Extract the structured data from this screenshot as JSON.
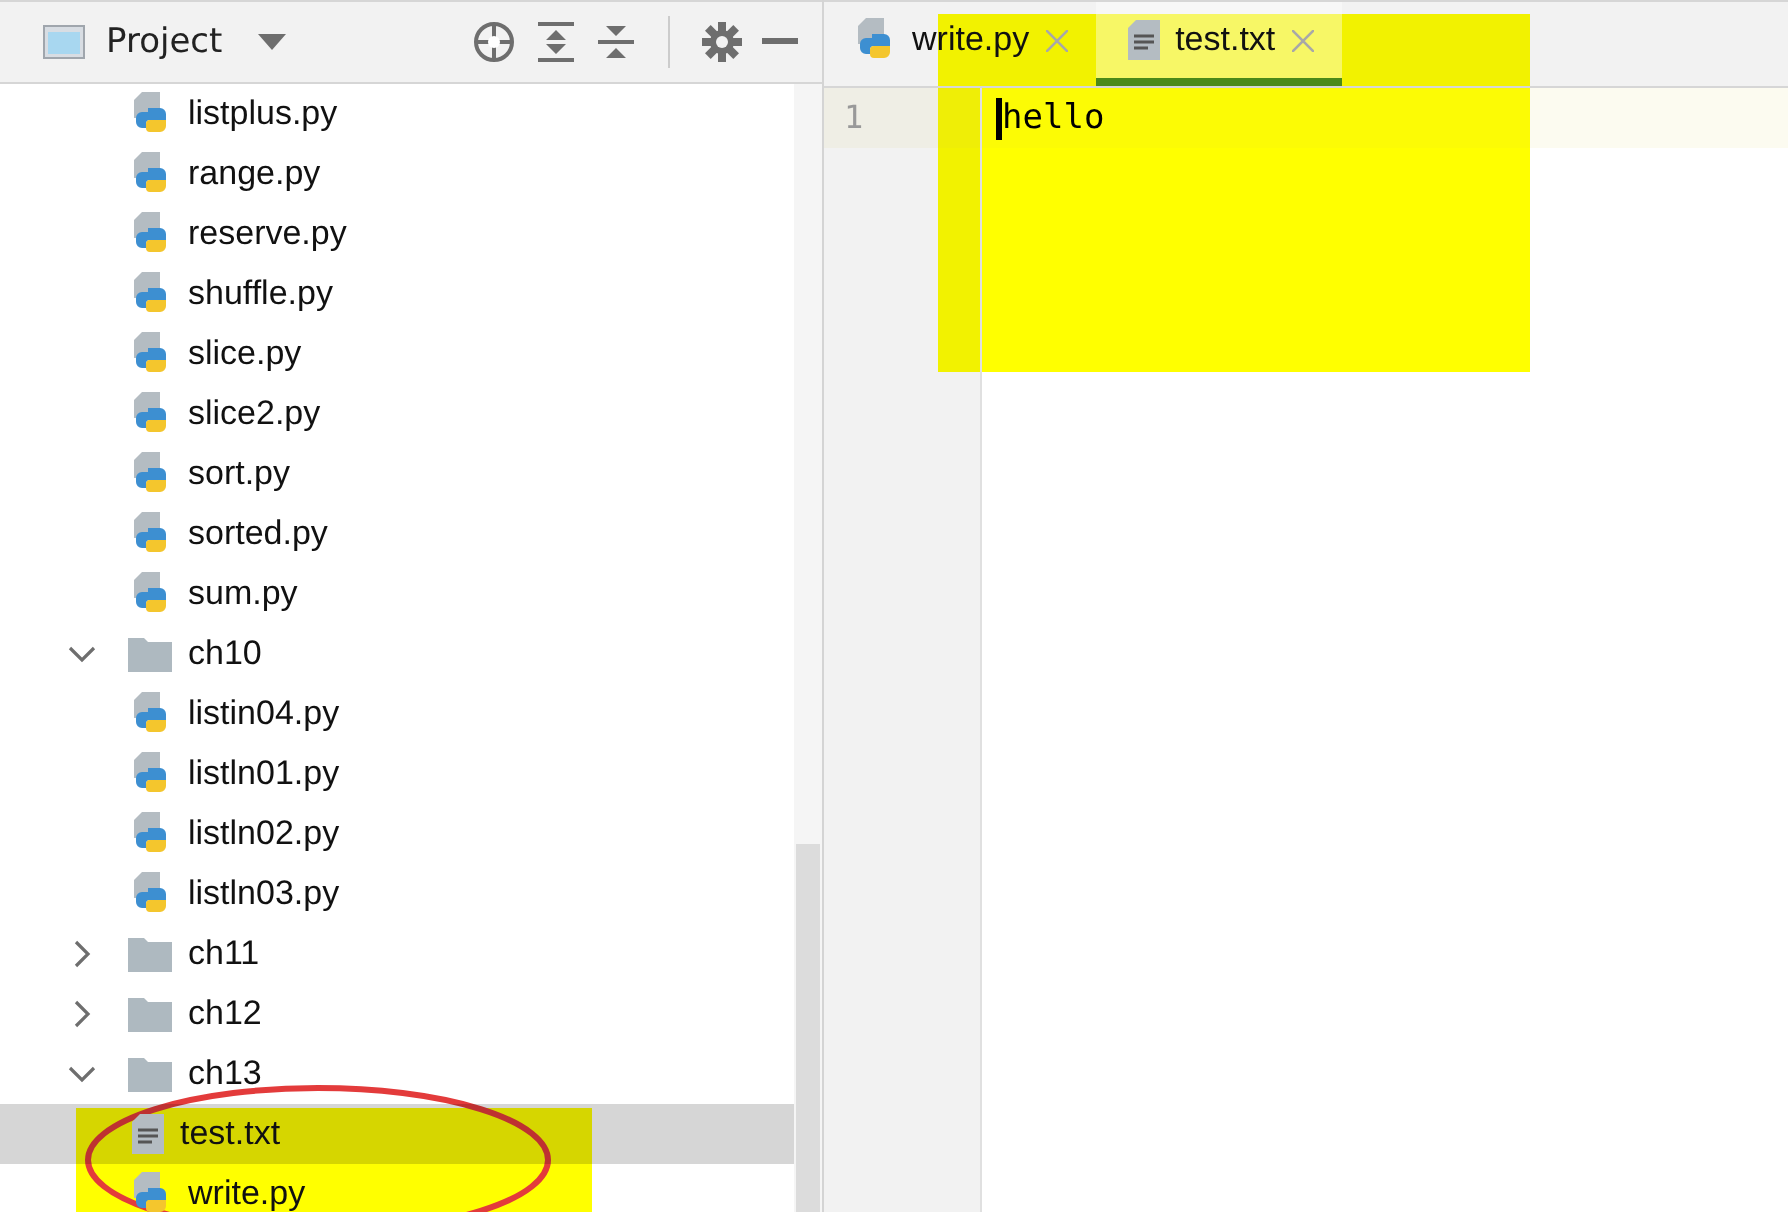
{
  "project_panel": {
    "title": "Project"
  },
  "tree": [
    {
      "kind": "group",
      "children": [
        {
          "kind": "python",
          "name": "listplus.py",
          "selected": false
        },
        {
          "kind": "python",
          "name": "range.py",
          "selected": false
        },
        {
          "kind": "python",
          "name": "reserve.py",
          "selected": false
        },
        {
          "kind": "python",
          "name": "shuffle.py",
          "selected": false
        },
        {
          "kind": "python",
          "name": "slice.py",
          "selected": false
        },
        {
          "kind": "python",
          "name": "slice2.py",
          "selected": false
        },
        {
          "kind": "python",
          "name": "sort.py",
          "selected": false
        },
        {
          "kind": "python",
          "name": "sorted.py",
          "selected": false
        },
        {
          "kind": "python",
          "name": "sum.py",
          "selected": false
        }
      ]
    },
    {
      "kind": "folder",
      "name": "ch10",
      "expanded": true,
      "selected": false,
      "children": [
        {
          "kind": "python",
          "name": "listin04.py",
          "selected": false
        },
        {
          "kind": "python",
          "name": "listln01.py",
          "selected": false
        },
        {
          "kind": "python",
          "name": "listln02.py",
          "selected": false
        },
        {
          "kind": "python",
          "name": "listln03.py",
          "selected": false
        }
      ]
    },
    {
      "kind": "folder",
      "name": "ch11",
      "expanded": false,
      "selected": false
    },
    {
      "kind": "folder",
      "name": "ch12",
      "expanded": false,
      "selected": false
    },
    {
      "kind": "folder",
      "name": "ch13",
      "expanded": true,
      "selected": false,
      "children": [
        {
          "kind": "text",
          "name": "test.txt",
          "selected": true
        },
        {
          "kind": "python",
          "name": "write.py",
          "selected": false
        }
      ]
    }
  ],
  "tabs": [
    {
      "kind": "python",
      "label": "write.py",
      "selected": false
    },
    {
      "kind": "text",
      "label": "test.txt",
      "selected": true
    }
  ],
  "editor": {
    "lines": [
      {
        "number": "1",
        "text": "hello"
      }
    ]
  },
  "annotations": [
    {
      "kind": "highlight"
    },
    {
      "kind": "highlight"
    },
    {
      "kind": "ellipse"
    }
  ]
}
